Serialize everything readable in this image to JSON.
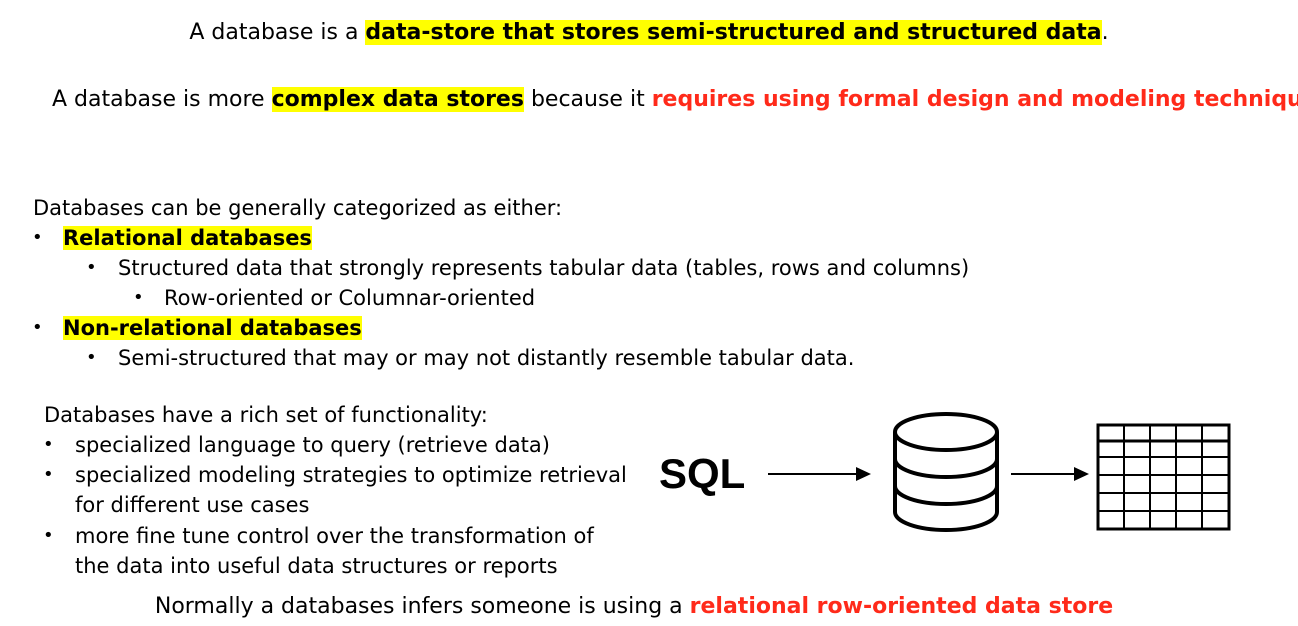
{
  "header": {
    "line1": {
      "prefix": "A database is a ",
      "highlight": "data-store that stores semi-structured and structured data",
      "suffix": "."
    },
    "line2": {
      "prefix": "A database is more ",
      "highlight": "complex data stores",
      "middle": " because it ",
      "emphasis": "requires using formal design and modeling techniques"
    }
  },
  "categories": {
    "intro": "Databases can be generally categorized as either:",
    "relational": {
      "label": "Relational databases",
      "detail": "Structured data that strongly represents tabular data (tables, rows and columns)",
      "subdetail": "Row-oriented or Columnar-oriented"
    },
    "nonrelational": {
      "label": "Non-relational databases",
      "detail": "Semi-structured that may or may not distantly resemble tabular data."
    }
  },
  "functionality": {
    "intro": "Databases have a rich set of functionality:",
    "items": [
      "specialized language to query (retrieve data)",
      "specialized modeling strategies to optimize retrieval",
      "for different use cases",
      "more fine tune control over the transformation of",
      "the data into useful data structures or reports"
    ]
  },
  "diagram": {
    "sql_label": "SQL",
    "icons": [
      "arrow-right-icon",
      "database-icon",
      "table-grid-icon"
    ]
  },
  "footer": {
    "prefix": "Normally a databases infers someone is using a ",
    "emphasis": "relational row-oriented data store"
  },
  "colors": {
    "highlight": "#ffff00",
    "emphasis_red": "#ff2a1a",
    "text": "#000000"
  },
  "bullet_char": "•"
}
